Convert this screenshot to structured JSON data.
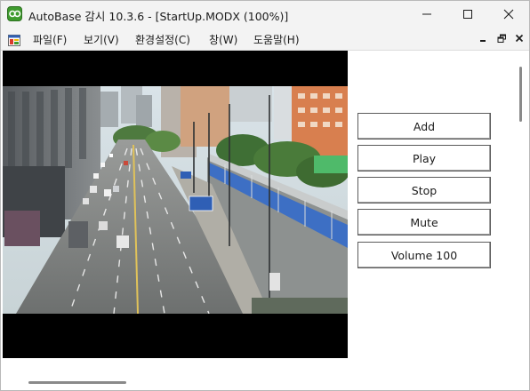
{
  "window": {
    "title": "AutoBase 감시 10.3.6 - [StartUp.MODX (100%)]"
  },
  "menu": {
    "items": [
      {
        "label": "파일(F)"
      },
      {
        "label": "보기(V)"
      },
      {
        "label": "환경설정(C)"
      },
      {
        "label": "창(W)"
      },
      {
        "label": "도움말(H)"
      }
    ]
  },
  "controls": {
    "buttons": [
      {
        "label": "Add"
      },
      {
        "label": "Play"
      },
      {
        "label": "Stop"
      },
      {
        "label": "Mute"
      },
      {
        "label": "Volume 100"
      }
    ]
  },
  "icons": {
    "app": "autobase-app-icon",
    "menu_doc": "document-icon",
    "minimize": "minimize-icon",
    "maximize": "maximize-icon",
    "close": "close-icon",
    "mdi_minimize": "mdi-minimize-icon",
    "mdi_restore": "mdi-restore-icon",
    "mdi_close": "mdi-close-icon"
  },
  "colors": {
    "title_bar": "#f3f3f3",
    "video_background": "#000000",
    "app_icon": "#3f9b2e"
  }
}
